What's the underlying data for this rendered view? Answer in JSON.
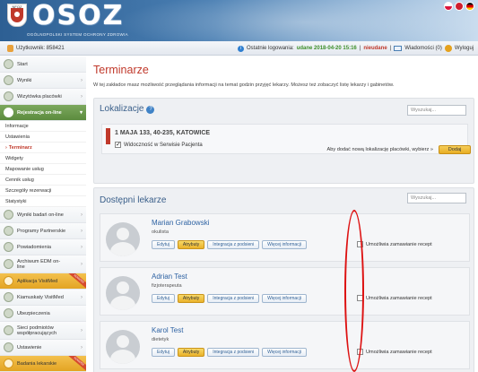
{
  "header": {
    "logo_text": "OSOZ",
    "subtitle": "OGÓLNOPOLSKI SYSTEM OCHRONY ZDROWIA",
    "emblem_text": "NFOZ"
  },
  "userbar": {
    "user_label": "Użytkownik: 858421",
    "last_login_label": "Ostatnie logowania:",
    "last_login_ok": "udane 2018-04-20 15:16",
    "last_login_failed": "nieudane",
    "messages_label": "Wiadomości (0)",
    "logout_label": "Wyloguj"
  },
  "sidebar": {
    "items": [
      {
        "label": "Start"
      },
      {
        "label": "Wyniki"
      },
      {
        "label": "Wizytówka placówki"
      },
      {
        "label": "Rejestracja on-line"
      }
    ],
    "sub_items": [
      {
        "label": "Informacje"
      },
      {
        "label": "Ustawienia"
      },
      {
        "label": "Terminarz"
      },
      {
        "label": "Widgety"
      },
      {
        "label": "Mapowanie usług"
      },
      {
        "label": "Cennik usług"
      },
      {
        "label": "Szczegóły rezerwacji"
      },
      {
        "label": "Statystyki"
      }
    ],
    "more_items": [
      {
        "label": "Wyniki badań on-line"
      },
      {
        "label": "Programy Partnerskie"
      },
      {
        "label": "Powiadomienia"
      },
      {
        "label": "Archiwum EDM on-line"
      },
      {
        "label": "Aplikacja VisitMed"
      },
      {
        "label": "Kiamuskaty VisitMed"
      },
      {
        "label": "Ubezpieczenia"
      },
      {
        "label": "Sieci podmiotów współpracujących"
      },
      {
        "label": "Ustawienie"
      },
      {
        "label": "Badania lekarskie"
      }
    ],
    "ribbon_text": "NOWOŚĆ"
  },
  "main": {
    "title": "Terminarze",
    "description": "W tej zakładce masz możliwość przeglądania informacji na temat godzin przyjęć lekarzy. Możesz też zobaczyć listę lekarzy i gabinetów.",
    "location_panel": {
      "heading": "Lokalizacje",
      "search_placeholder": "Wyszukaj...",
      "location_name": "1 MAJA 133, 40-235, KATOWICE",
      "visibility_label": "Widoczność w Serwisie Pacjenta",
      "visibility_checked": true,
      "add_text": "Aby dodać nową lokalizację placówki, wybierz »",
      "add_button": "Dodaj"
    },
    "doctors_panel": {
      "heading": "Dostępni lekarze",
      "search_placeholder": "Wyszukaj...",
      "action_labels": {
        "edit": "Edytuj",
        "attributes": "Atrybuty",
        "integration": "Integracja z podsieni",
        "more": "Więcej informacji"
      },
      "doctors": [
        {
          "name": "Marian Grabowski",
          "specialty": "okulista",
          "rx_label": "Umożliwia zamawianie recept"
        },
        {
          "name": "Adrian Test",
          "specialty": "fizjoterapeuta",
          "rx_label": "Umożliwia zamawianie recept"
        },
        {
          "name": "Karol Test",
          "specialty": "dietetyk",
          "rx_label": "Umożliwia zamawianie recept"
        }
      ]
    }
  },
  "colors": {
    "accent_red": "#c0392b",
    "nav_green": "#5b8b3e",
    "button_yellow": "#e7ad22",
    "annotation_red": "#dd1111"
  }
}
